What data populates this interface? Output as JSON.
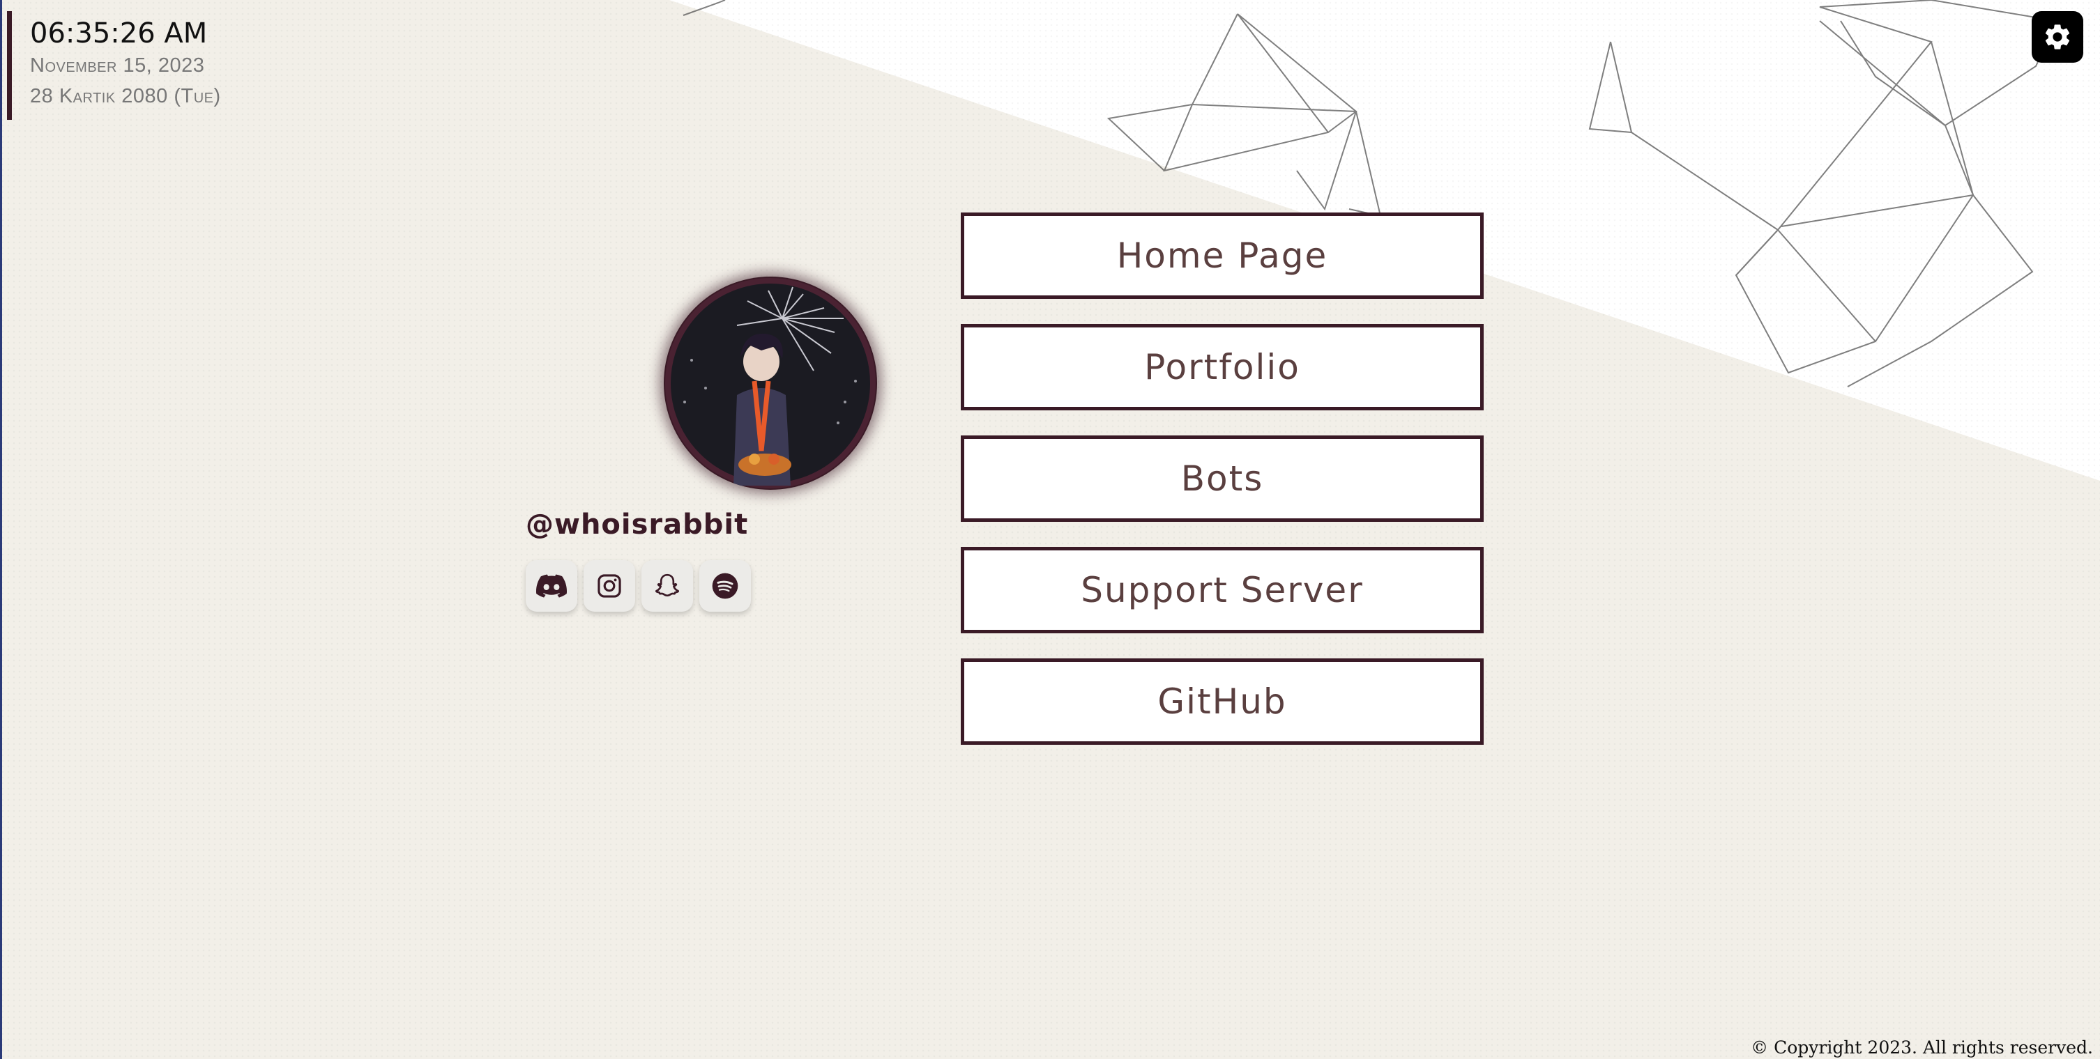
{
  "clock": {
    "time": "06:35:26 AM",
    "date": "November 15, 2023",
    "nepali_date": "28 Kartik 2080 (Tue)"
  },
  "settings": {
    "icon": "gear-icon"
  },
  "profile": {
    "username": "@whoisrabbit",
    "avatar": "avatar-image"
  },
  "socials": [
    {
      "name": "discord",
      "icon": "discord-icon"
    },
    {
      "name": "instagram",
      "icon": "instagram-icon"
    },
    {
      "name": "snapchat",
      "icon": "snapchat-icon"
    },
    {
      "name": "spotify",
      "icon": "spotify-icon"
    }
  ],
  "menu": [
    {
      "label": "Home Page"
    },
    {
      "label": "Portfolio"
    },
    {
      "label": "Bots"
    },
    {
      "label": "Support Server"
    },
    {
      "label": "GitHub"
    }
  ],
  "footer": {
    "copyright": "© Copyright 2023. All rights reserved."
  },
  "colors": {
    "background": "#f2efe8",
    "accent": "#3a1a26",
    "button_text": "#5a3f3f"
  }
}
